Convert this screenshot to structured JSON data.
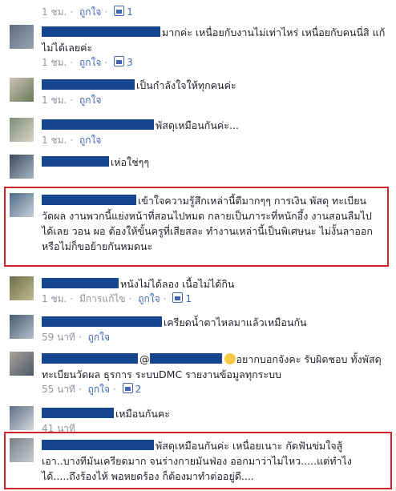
{
  "comments": [
    {
      "text": "",
      "meta": {
        "time": "1 ชม.",
        "like_label": "ถูกใจ",
        "like_count": "1"
      }
    },
    {
      "text": "มากค่ะ เหนื่อยกับงานไม่เท่าไหร่ เหนื่อยกับคนนี่สิ แก้ไม่ได้เลยค่ะ",
      "meta": {
        "time": "1 ชม.",
        "like_label": "ถูกใจ",
        "like_count": "3"
      }
    },
    {
      "text": "เป็นกำลังใจให้ทุกคนค่ะ",
      "meta": {
        "time": "1 ชม.",
        "like_label": "ถูกใจ"
      }
    },
    {
      "text": "พัสดุเหมือนกันค่ะ...",
      "meta": {
        "time": "1 ชม.",
        "like_label": "ถูกใจ"
      }
    },
    {
      "text": "เห่อใช่ๆๆ"
    },
    {
      "text": "เข้าใจความรู้สึกเหล่านี้ดีมากๆๆ การเงิน พัสดุ ทะเบียนวัดผล งานพวกนี้แย่งหน้าที่สอนไปหมด กลายเป็นภาระที่หนักอึ้ง งานสอนลืมไปได้เลย วอน ผอ ต้องให้ขั้นครูที่เสียสละ ทำงานเหล่านี้เป็นพิเศษนะ ไม่งั้นลาออก หรือไม่ก็ขอย้ายกันหมดนะ"
    },
    {
      "text": "หนังไม่ได้ลอง เนื้อไม่ได้กิน",
      "meta": {
        "time": "1 ชม.",
        "edited": "มีการแก้ไข",
        "like_label": "ถูกใจ",
        "like_count": "1"
      }
    },
    {
      "text": "เครียดน้ำตาไหลมาแล้วเหมือนกัน",
      "meta": {
        "time": "59 นาที",
        "like_label": "ถูกใจ"
      }
    },
    {
      "text_a": "@",
      "text_b": "อยากบอกจังคะ รับผิดชอบ ทั้งพัสดุ ทะเบียนวัดผล ธุรการ ระบบDMC รายงานข้อมูลทุกระบบ",
      "meta": {
        "time": "55 นาที",
        "like_label": "ถูกใจ",
        "like_count": "2"
      }
    },
    {
      "text": "เหมือนกันคะ",
      "meta": {
        "time": "41 นาที"
      }
    },
    {
      "text": "พัสดุเหมือนกันค่ะ เหนื่อยเนาะ กัดฟันข่มใจสู้ เอา..บางทีมันเครียดมาก จนร่างกายมันฟ่อง ออกมาว่าไม่ไหว.....แต่ทำไงได้.....ถึงร้องไห้ พอหยดร้อง ก็ต้องมาทำต่ออยู่ดี...."
    }
  ],
  "colors": {
    "redact": "#16478e",
    "highlight": "#d1232a",
    "link": "#4267b2",
    "meta": "#90949c"
  }
}
